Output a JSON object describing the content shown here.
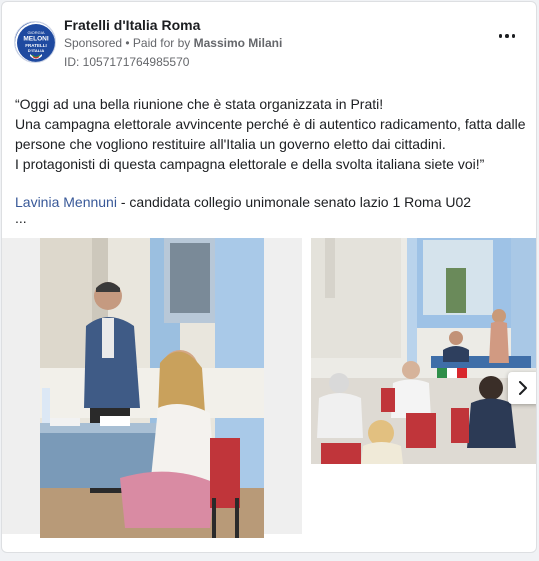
{
  "post": {
    "page_name": "Fratelli d'Italia Roma",
    "sponsored": "Sponsored",
    "separator": " • ",
    "paid_for_by": "Paid for by ",
    "sponsor_name": "Massimo Milani",
    "ad_id": "ID: 1057171764985570",
    "avatar_lines": [
      "GIORGIA",
      "MELONI",
      "FRATELLI",
      "D'ITALIA"
    ],
    "more_icon": "more-horizontal-icon",
    "body": [
      "“Oggi ad una bella riunione che è stata organizzata in Prati!",
      "Una campagna elettorale avvincente perché è di autentico radicamento, fatta dalle persone che vogliono restituire all'Italia un governo eletto dai cittadini.",
      "I protagonisti di questa campagna elettorale e della svolta italiana siete voi!”"
    ],
    "author_link": "Lavinia Mennuni",
    "author_rest": " - candidata collegio unimonale senato lazio 1 Roma U02",
    "see_more": "...",
    "next_icon": "chevron-right-icon"
  },
  "colors": {
    "link": "#385898",
    "secondary_text": "#65676b",
    "brand_blue": "#1f4aa0"
  }
}
